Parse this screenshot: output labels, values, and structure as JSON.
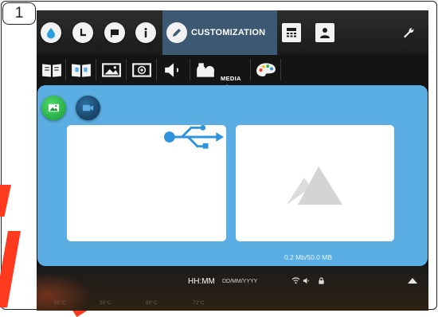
{
  "figure": {
    "step_number": "1"
  },
  "topbar": {
    "tabs": [
      {
        "id": "water",
        "icon": "water-drop-icon"
      },
      {
        "id": "timer",
        "icon": "clock-icon"
      },
      {
        "id": "flag",
        "icon": "flag-icon"
      },
      {
        "id": "info",
        "icon": "info-icon"
      }
    ],
    "active_tab_label": "CUSTOMIZATION",
    "active_tab_icon": "pencil-icon",
    "right_icons": [
      "calculator-icon",
      "user-badge-icon"
    ],
    "settings_icon": "wrench-icon"
  },
  "subbar": {
    "items": [
      "open-book-icon",
      "manual-book-icon",
      "screen-image-icon",
      "screensaver-icon",
      "speaker-icon",
      "media-icon",
      "palette-icon"
    ],
    "active_item_label": "MEDIA"
  },
  "media_panel": {
    "source_buttons": [
      "image-source-icon",
      "video-source-icon"
    ],
    "usb_icon": "usb-icon",
    "placeholder_icon": "mountain-image-icon",
    "storage_text": "0.2 Mb/50.0 MB"
  },
  "statusbar": {
    "temperatures": [
      "55°C",
      "55°C",
      "60°C",
      "72°C"
    ],
    "time": "HH:MM",
    "date_format": "DD/MM/YYYY",
    "status_icons": [
      "wifi-icon",
      "volume-icon",
      "lock-icon"
    ],
    "expand_icon": "chevron-up-icon"
  },
  "colors": {
    "panel_blue": "#5aaee3",
    "active_tab": "#3d5873",
    "usb_blue": "#2f94d9",
    "image_green": "#2fb84f",
    "video_navy": "#0f2f4a",
    "annotation_red": "#ff3b1f"
  }
}
